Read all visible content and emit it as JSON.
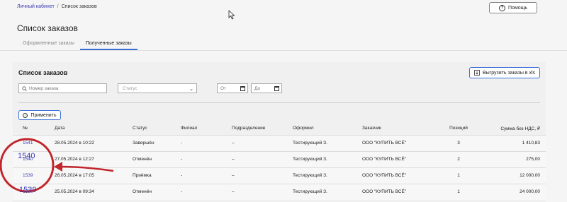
{
  "breadcrumb": {
    "home": "Личный кабинет",
    "sep": "/",
    "current": "Список заказов"
  },
  "help_button": "Помощь",
  "page_title": "Список заказов",
  "tabs": [
    {
      "label": "Оформленные заказы"
    },
    {
      "label": "Полученные заказы"
    }
  ],
  "panel": {
    "title": "Список заказов",
    "export_label": "Выгрузить заказы в xls",
    "search_placeholder": "Номер заказа",
    "status_placeholder": "Статус",
    "date_from_placeholder": "От",
    "date_to_placeholder": "До",
    "apply_label": "Применить"
  },
  "table": {
    "headers": [
      "№",
      "Дата",
      "Статус",
      "Филиал",
      "Подразделение",
      "Оформил",
      "Заказчик",
      "Позиций",
      "Сумма без НДС, ₽"
    ],
    "rows": [
      [
        "1541",
        "28.05.2024 в 10:22",
        "Завершён",
        "-",
        "–",
        "Тестирующий З.",
        "ООО \"КУПИТЬ ВСЁ\"",
        "3",
        "1 410,83"
      ],
      [
        "1540",
        "27.05.2024 в 12:27",
        "Отменён",
        "-",
        "–",
        "Тестирующий З.",
        "ООО \"КУПИТЬ ВСЁ\"",
        "2",
        "275,00"
      ],
      [
        "1539",
        "26.05.2024 в 17:05",
        "Приёмка",
        "-",
        "–",
        "Тестирующий З.",
        "ООО \"КУПИТЬ ВСЁ\"",
        "1",
        "12 000,00"
      ],
      [
        "1538",
        "25.05.2024 в 09:34",
        "Отменён",
        "-",
        "–",
        "Тестирующий З.",
        "ООО \"КУПИТЬ ВСЁ\"",
        "1",
        "24 000,00"
      ]
    ]
  },
  "annotation": {
    "zoom_label_1": "1540",
    "zoom_label_2": "1539",
    "color": "#c0262c"
  }
}
